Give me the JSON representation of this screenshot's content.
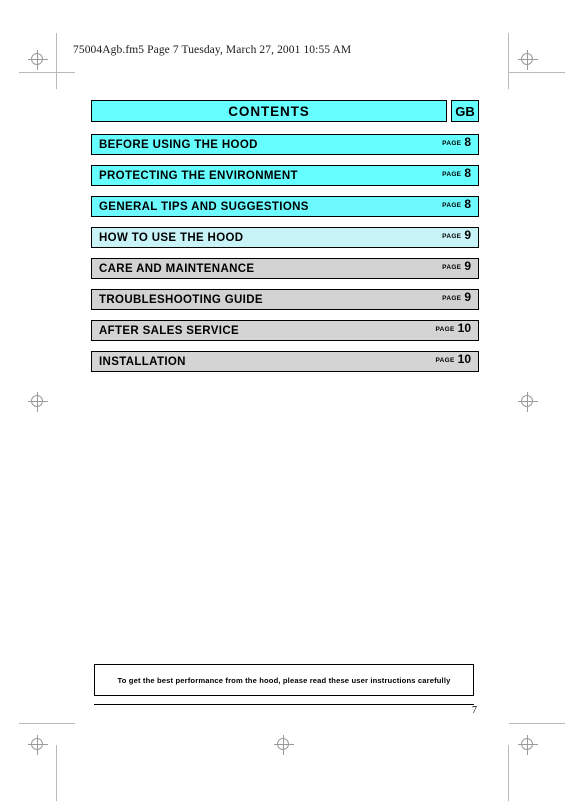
{
  "document": {
    "file_header": "75004Agb.fm5  Page 7  Tuesday, March 27, 2001  10:55 AM",
    "page_number": "7"
  },
  "header": {
    "title": "CONTENTS",
    "language_code": "GB"
  },
  "toc": {
    "page_label": "PAGE",
    "rows": [
      {
        "title": "BEFORE USING THE HOOD",
        "page_label": "PAGE",
        "page": "8",
        "bg": "#66ffff"
      },
      {
        "title": "PROTECTING THE ENVIRONMENT",
        "page_label": "PAGE",
        "page": "8",
        "bg": "#66ffff"
      },
      {
        "title": "GENERAL TIPS AND SUGGESTIONS",
        "page_label": "PAGE",
        "page": "8",
        "bg": "#6cfaff"
      },
      {
        "title": "HOW TO USE THE HOOD",
        "page_label": "PAGE",
        "page": "9",
        "bg": "#c9f4f7"
      },
      {
        "title": "CARE AND MAINTENANCE",
        "page_label": "PAGE",
        "page": "9",
        "bg": "#d2d2d2"
      },
      {
        "title": "TROUBLESHOOTING GUIDE",
        "page_label": "PAGE",
        "page": "9",
        "bg": "#d2d2d2"
      },
      {
        "title": "AFTER SALES SERVICE",
        "page_label": "PAGE",
        "page": "10",
        "bg": "#d4d4d4"
      },
      {
        "title": "INSTALLATION",
        "page_label": "PAGE",
        "page": "10",
        "bg": "#d4d4d4"
      }
    ]
  },
  "footer": {
    "note": "To get the best performance from the hood, please read these user instructions carefully"
  },
  "colors": {
    "accent_cyan": "#66ffff",
    "row_gray": "#d2d2d2",
    "border": "#000000",
    "crop_mark": "#9a9a9a"
  }
}
